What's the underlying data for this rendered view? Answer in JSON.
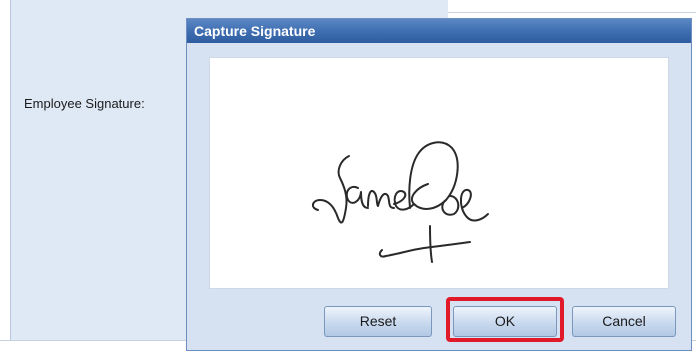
{
  "form": {
    "field_label": "Employee Signature:"
  },
  "dialog": {
    "title": "Capture Signature",
    "signature_text": "Jane Doe",
    "buttons": {
      "reset": "Reset",
      "ok": "OK",
      "cancel": "Cancel"
    },
    "highlighted_button": "ok"
  },
  "colors": {
    "title_bar": "#3f6fb2",
    "dialog_background": "#d6e2f1",
    "highlight": "#e11a2a"
  }
}
